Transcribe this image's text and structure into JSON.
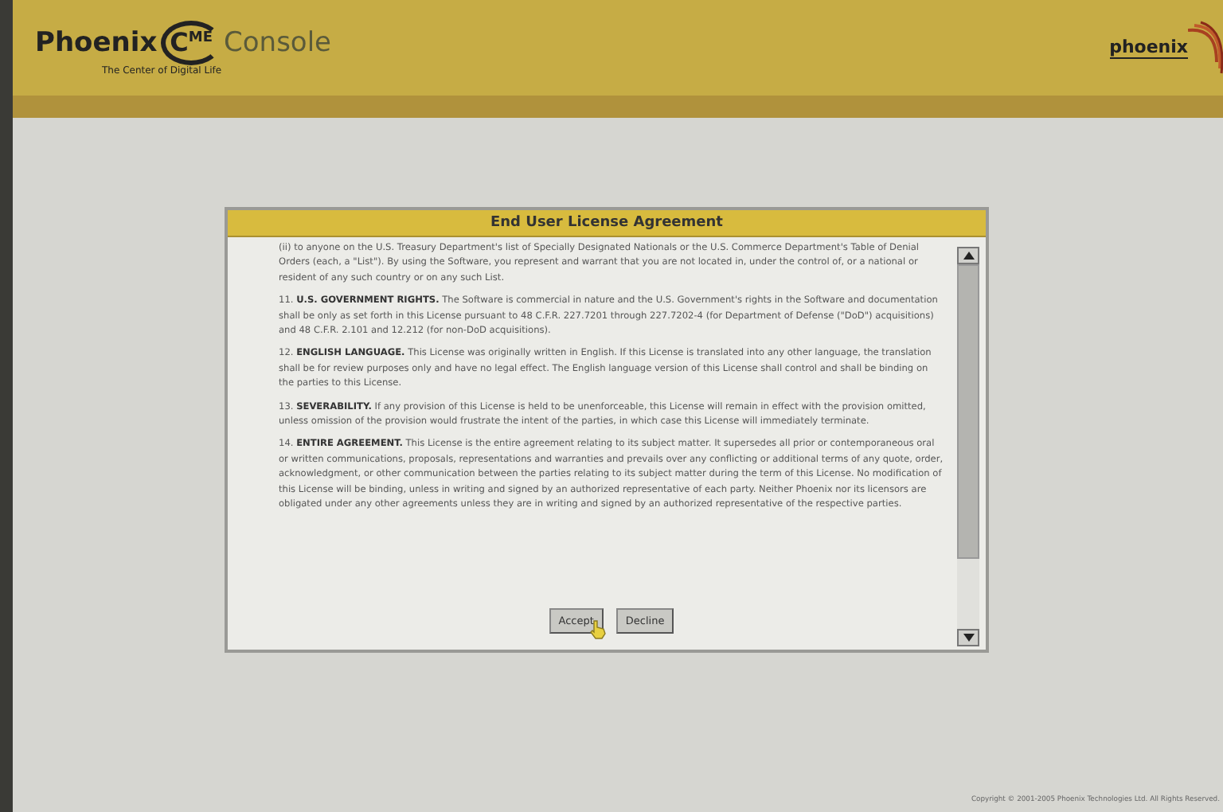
{
  "header": {
    "brand": "Phoenix",
    "badge_c": "C",
    "badge_me": "ME",
    "product": "Console",
    "tagline": "The Center of Digital Life",
    "logo": "phoenix"
  },
  "dialog": {
    "title": "End User License Agreement",
    "paragraphs": [
      "(ii) to anyone on the U.S. Treasury Department's list of Specially Designated Nationals or the U.S. Commerce Department's Table of Denial Orders (each, a \"List\"). By using the Software, you represent and warrant that you are not located in, under the control of, or a national or resident of any such country or on any such List.",
      "11. **U.S. GOVERNMENT RIGHTS.** The Software is commercial in nature and the U.S. Government's rights in the Software and documentation shall be only as set forth in this License pursuant to 48 C.F.R. 227.7201 through 227.7202-4 (for Department of Defense (\"DoD\") acquisitions) and 48 C.F.R. 2.101 and 12.212 (for non-DoD acquisitions).",
      "12. **ENGLISH LANGUAGE.** This License was originally written in English. If this License is translated into any other language, the translation shall be for review purposes only and have no legal effect. The English language version of this License shall control and shall be binding on the parties to this License.",
      "13. **SEVERABILITY.** If any provision of this License is held to be unenforceable, this License will remain in effect with the provision omitted, unless omission of the provision would frustrate the intent of the parties, in which case this License will immediately terminate.",
      "14. **ENTIRE AGREEMENT.** This License is the entire agreement relating to its subject matter. It supersedes all prior or contemporaneous oral or written communications, proposals, representations and warranties and prevails over any conflicting or additional terms of any quote, order, acknowledgment, or other communication between the parties relating to its subject matter during the term of this License. No modification of this License will be binding, unless in writing and signed by an authorized representative of each party. Neither Phoenix nor its licensors are obligated under any other agreements unless they are in writing and signed by an authorized representative of the respective parties."
    ],
    "buttons": [
      "Accept",
      "Decline"
    ]
  },
  "footer": "Copyright © 2001-2005 Phoenix Technologies Ltd. All Rights Reserved."
}
